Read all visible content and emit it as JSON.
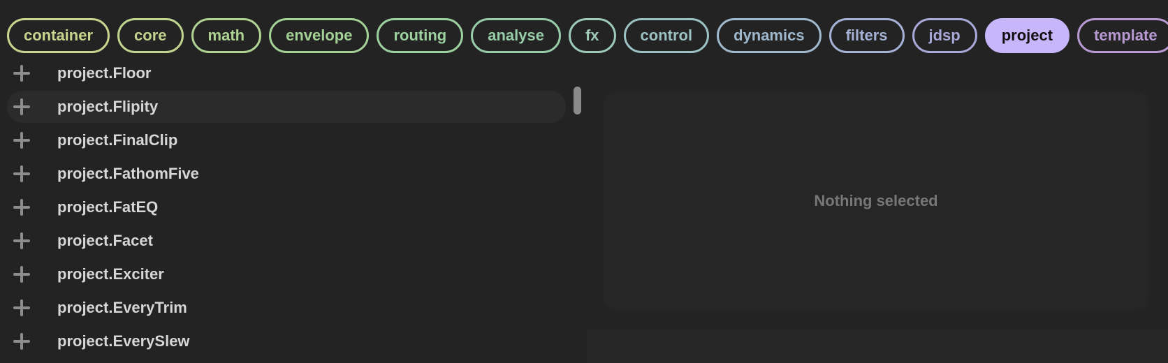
{
  "tags": [
    {
      "label": "container",
      "color": "#c9d48e",
      "active": false
    },
    {
      "label": "core",
      "color": "#c1d48f",
      "active": false
    },
    {
      "label": "math",
      "color": "#afd392",
      "active": false
    },
    {
      "label": "envelope",
      "color": "#a4d196",
      "active": false
    },
    {
      "label": "routing",
      "color": "#9cd09e",
      "active": false
    },
    {
      "label": "analyse",
      "color": "#97cca8",
      "active": false
    },
    {
      "label": "fx",
      "color": "#9ccab6",
      "active": false
    },
    {
      "label": "control",
      "color": "#9cc1c2",
      "active": false
    },
    {
      "label": "dynamics",
      "color": "#a0b8cc",
      "active": false
    },
    {
      "label": "filters",
      "color": "#a5b1d5",
      "active": false
    },
    {
      "label": "jdsp",
      "color": "#a8a8d9",
      "active": false
    },
    {
      "label": "project",
      "color": "#c7b7fa",
      "active": true
    },
    {
      "label": "template",
      "color": "#b89ad3",
      "active": false
    }
  ],
  "modules": [
    {
      "label": "project.Floor"
    },
    {
      "label": "project.Flipity",
      "hovered": true
    },
    {
      "label": "project.FinalClip"
    },
    {
      "label": "project.FathomFive"
    },
    {
      "label": "project.FatEQ"
    },
    {
      "label": "project.Facet"
    },
    {
      "label": "project.Exciter"
    },
    {
      "label": "project.EveryTrim"
    },
    {
      "label": "project.EverySlew"
    }
  ],
  "detail": {
    "empty_text": "Nothing selected"
  },
  "icons": {
    "add": "plus-icon"
  }
}
